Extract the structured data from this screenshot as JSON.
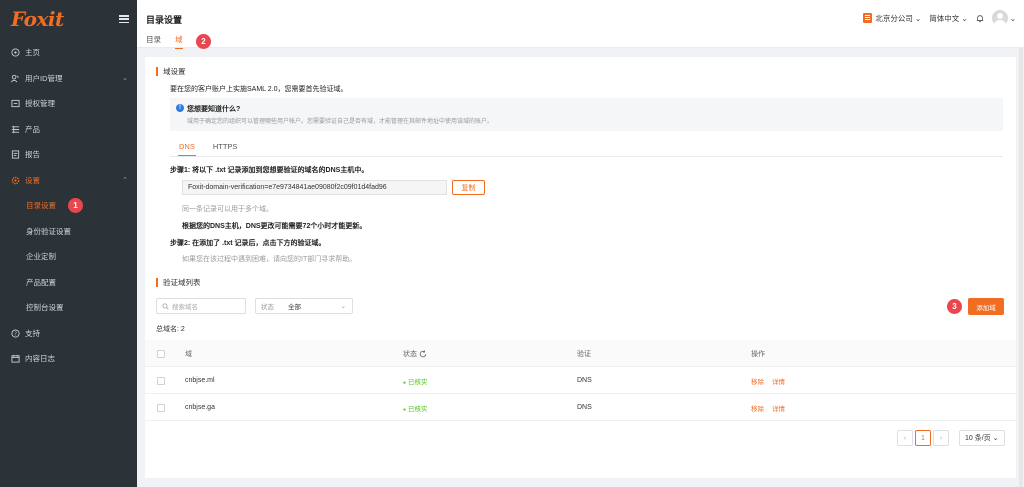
{
  "brand": {
    "logo": "Foxit",
    "accent": "#f26c22"
  },
  "sidebar": {
    "items": [
      {
        "label": "主页",
        "icon": "home-icon"
      },
      {
        "label": "用户ID管理",
        "icon": "users-icon"
      },
      {
        "label": "授权管理",
        "icon": "license-icon"
      },
      {
        "label": "产品",
        "icon": "product-icon"
      },
      {
        "label": "报告",
        "icon": "report-icon"
      },
      {
        "label": "设置",
        "icon": "gear-icon"
      }
    ],
    "settings_sub": [
      "目录设置",
      "身份验证设置",
      "企业定制",
      "产品配置",
      "控制台设置"
    ],
    "items_bottom": [
      {
        "label": "支持",
        "icon": "help-icon"
      },
      {
        "label": "内容日志",
        "icon": "log-icon"
      }
    ]
  },
  "annotations": [
    "1",
    "2",
    "3"
  ],
  "header": {
    "title": "目录设置",
    "tabs": [
      "目录",
      "域"
    ],
    "org": "北京分公司",
    "language": "简体中文"
  },
  "domain_settings": {
    "section_title": "域设置",
    "intro": "要在您的客户账户上实施SAML 2.0，您需要首先验证域。",
    "info_title": "您想要知道什么?",
    "info_body": "域用于确定您的组织可以管理哪些用户帐户。您需要验证自己是否有域，才能管理在其邮件地址中使用该域的账户。",
    "subtabs": [
      "DNS",
      "HTTPS"
    ],
    "step1": "步骤1: 将以下 .txt 记录添加到您想要验证的域名的DNS主机中。",
    "txt_record": "Foxit-domain-verification=e7e9734841ae09080f2c09f01d4fad96",
    "copy_label": "复制",
    "note1": "同一条记录可以用于多个域。",
    "note2": "根据您的DNS主机，DNS更改可能需要72个小时才能更新。",
    "step2": "步骤2: 在添加了 .txt 记录后，点击下方的验证域。",
    "note3": "如果您在该过程中遇到困难，请向您的IT部门寻求帮助。"
  },
  "domain_list": {
    "section_title": "验证域列表",
    "search_placeholder": "搜索域名",
    "status_filter_label": "状态",
    "status_filter_value": "全部",
    "add_label": "添加域",
    "total": "总域名: 2",
    "columns": [
      "域",
      "状态",
      "验证",
      "操作"
    ],
    "rows": [
      {
        "domain": "cnbjse.ml",
        "status": "已核实",
        "verify": "DNS",
        "remove": "移除",
        "detail": "详情"
      },
      {
        "domain": "cnbjse.ga",
        "status": "已核实",
        "verify": "DNS",
        "remove": "移除",
        "detail": "详情"
      }
    ],
    "pagination": {
      "page": "1",
      "page_size": "10 条/页"
    }
  }
}
